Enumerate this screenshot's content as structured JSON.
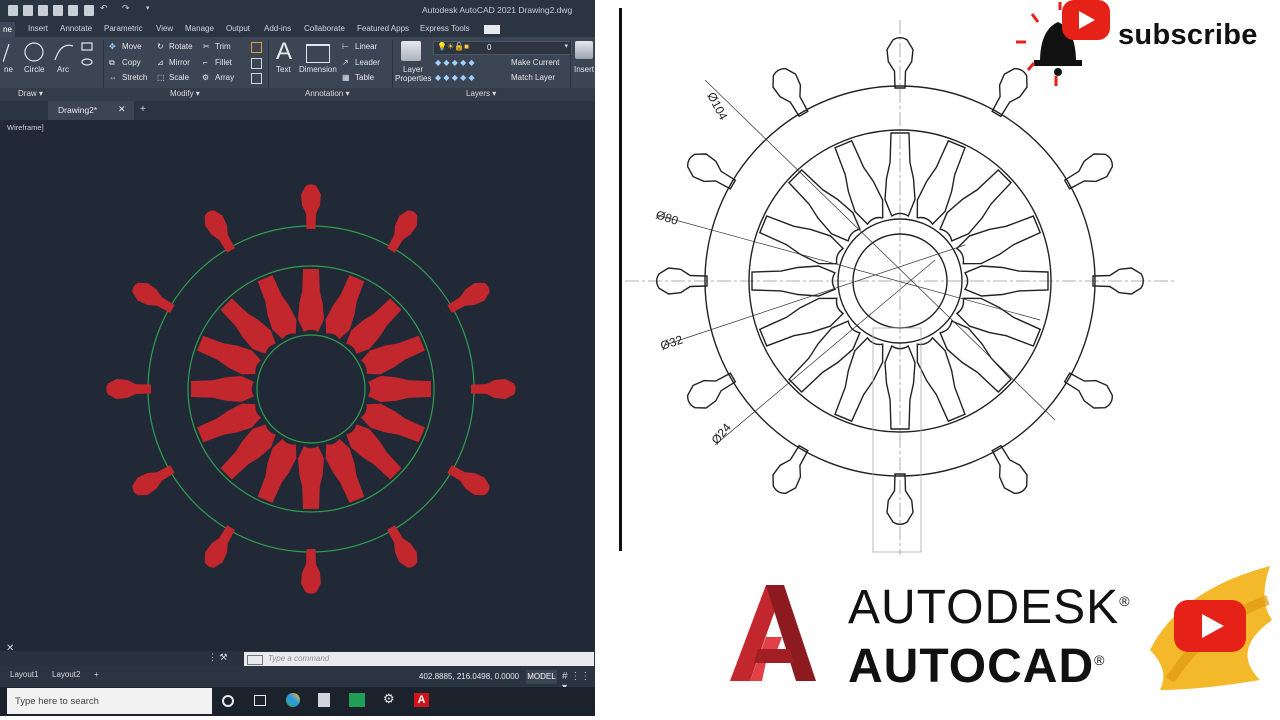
{
  "window_title": "Autodesk AutoCAD 2021    Drawing2.dwg",
  "ribbon_tabs": [
    "ne",
    "Insert",
    "Annotate",
    "Parametric",
    "View",
    "Manage",
    "Output",
    "Add-ins",
    "Collaborate",
    "Featured Apps",
    "Express Tools"
  ],
  "draw_tools": {
    "line_partial": "ne",
    "circle": "Circle",
    "arc": "Arc"
  },
  "modify_tools": [
    "Move",
    "Rotate",
    "Trim",
    "Copy",
    "Mirror",
    "Fillet",
    "Stretch",
    "Scale",
    "Array"
  ],
  "annotation_tools": {
    "text": "Text",
    "dimension": "Dimension",
    "linear": "Linear",
    "leader": "Leader",
    "table": "Table"
  },
  "layers_tools": {
    "layer_properties_line1": "Layer",
    "layer_properties_line2": "Properties",
    "layer_name": "0",
    "make_current": "Make Current",
    "match_layer": "Match Layer"
  },
  "insert_label": "Insert",
  "panel_labels": {
    "draw": "Draw",
    "modify": "Modify",
    "annotation": "Annotation",
    "layers": "Layers"
  },
  "document_tab": "Drawing2*",
  "viewport_label": "Wireframe]",
  "command_placeholder": "Type  a  command",
  "layout_tabs": [
    "Layout1",
    "Layout2"
  ],
  "coordinates": "402.8885, 216.0498, 0.0000",
  "model_label": "MODEL",
  "taskbar_search": "Type here to search",
  "dimensions": [
    "Ø104",
    "Ø80",
    "Ø32",
    "Ø24"
  ],
  "subscribe": "subscribe",
  "brand_line1": "AUTODESK",
  "brand_line2": "AUTOCAD",
  "registered_mark": "®",
  "colors": {
    "cad_bg": "#212936",
    "spoke_red": "#c1272d",
    "cad_green": "#2f9e4e",
    "youtube_red": "#e62117",
    "gold": "#f2b51f"
  }
}
